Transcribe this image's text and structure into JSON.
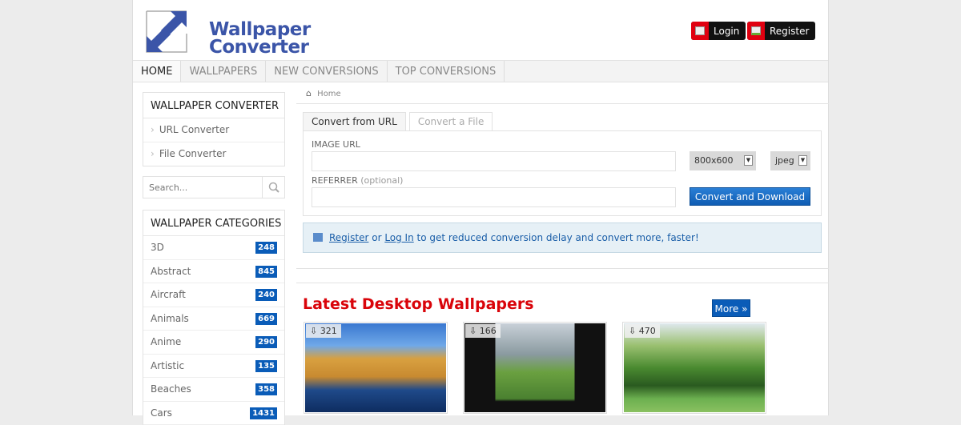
{
  "logo": {
    "line1": "Wallpaper",
    "line2": "Converter"
  },
  "auth": {
    "login": "Login",
    "register": "Register"
  },
  "nav": [
    "HOME",
    "WALLPAPERS",
    "NEW CONVERSIONS",
    "TOP CONVERSIONS"
  ],
  "sidebar": {
    "converter_title": "WALLPAPER CONVERTER",
    "converter_items": [
      "URL Converter",
      "File Converter"
    ],
    "search_placeholder": "Search...",
    "categories_title": "WALLPAPER CATEGORIES",
    "categories": [
      {
        "name": "3D",
        "count": "248"
      },
      {
        "name": "Abstract",
        "count": "845"
      },
      {
        "name": "Aircraft",
        "count": "240"
      },
      {
        "name": "Animals",
        "count": "669"
      },
      {
        "name": "Anime",
        "count": "290"
      },
      {
        "name": "Artistic",
        "count": "135"
      },
      {
        "name": "Beaches",
        "count": "358"
      },
      {
        "name": "Cars",
        "count": "1431"
      }
    ]
  },
  "breadcrumb": "Home",
  "tabs": [
    "Convert from URL",
    "Convert a File"
  ],
  "form": {
    "image_url_label": "IMAGE URL",
    "referrer_label": "REFERRER",
    "referrer_optional": "(optional)",
    "size": "800x600",
    "format": "jpeg",
    "submit": "Convert and Download"
  },
  "notice": {
    "register": "Register",
    "or": " or ",
    "login": "Log In",
    "rest": " to get reduced conversion delay and convert more, faster!"
  },
  "latest": {
    "title": "Latest Desktop Wallpapers",
    "more": "More »",
    "thumbs": [
      {
        "count": "321"
      },
      {
        "count": "166"
      },
      {
        "count": "470"
      }
    ]
  }
}
